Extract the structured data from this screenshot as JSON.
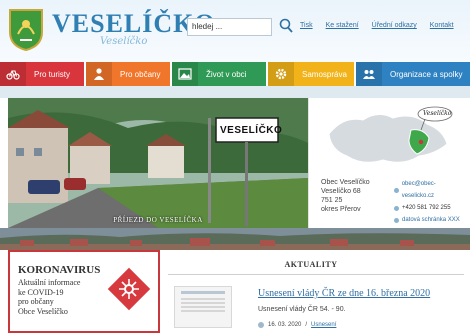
{
  "header": {
    "site_title": "VESELÍČKO",
    "script_text": "Veselíčko",
    "search_placeholder": "hledej ...",
    "links": [
      "Tisk",
      "Ke stažení",
      "Úřední odkazy",
      "Kontakt"
    ]
  },
  "nav": [
    {
      "label": "Pro turisty",
      "icon": "bicycle-icon",
      "color": "#d8353c"
    },
    {
      "label": "Pro občany",
      "icon": "person-icon",
      "color": "#f0762b"
    },
    {
      "label": "Život v obci",
      "icon": "picture-icon",
      "color": "#2f9a55"
    },
    {
      "label": "Samospráva",
      "icon": "gear-icon",
      "color": "#f1b319"
    },
    {
      "label": "Organizace a spolky",
      "icon": "group-icon",
      "color": "#2f82c2"
    }
  ],
  "hero": {
    "sign_text": "VESELÍČKO",
    "caption": "PŘÍJEZD DO VESELÍČKA"
  },
  "map": {
    "bubble_text": "Veselíčko"
  },
  "address": {
    "lines": [
      "Obec Veselíčko",
      "Veselíčko 68",
      "751 25",
      "okres Přerov"
    ]
  },
  "contacts": {
    "email": "obec@obec-veselicko.cz",
    "phone": "+420 581 792 255",
    "data_box": "datová schránka XXX"
  },
  "corona": {
    "title": "KORONAVIRUS",
    "lines": [
      "Aktuální informace",
      "ke COVID-19",
      "pro občany",
      "Obce Veselíčko"
    ]
  },
  "news": {
    "heading": "AKTUALITY",
    "title": "Usnesení vlády ČR ze dne 16. března 2020",
    "subtitle": "Usnesení vlády ČR 54. - 90.",
    "item_date": "16. 03. 2020",
    "item_link": "Usnesení"
  }
}
